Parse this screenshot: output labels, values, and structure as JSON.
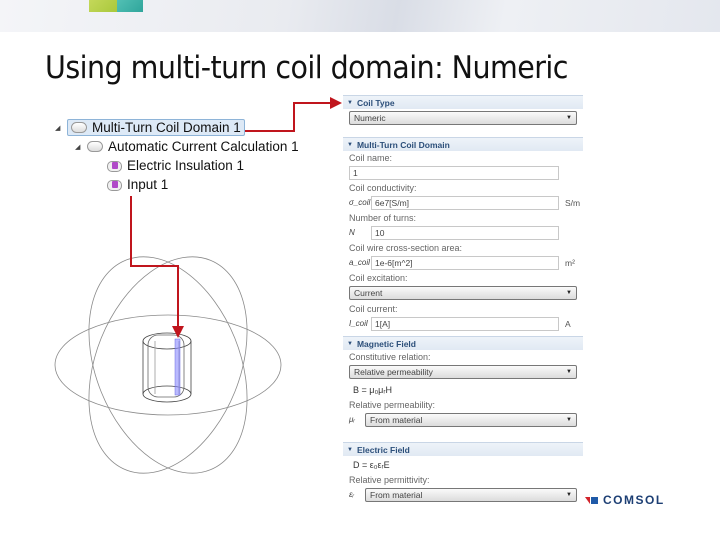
{
  "slide": {
    "title": "Using multi-turn coil domain: Numeric"
  },
  "tree": {
    "items": [
      {
        "label": "Multi-Turn Coil Domain 1",
        "icon": "domain-node-icon",
        "selected": true
      },
      {
        "label": "Automatic Current Calculation 1",
        "icon": "domain-node-icon"
      },
      {
        "label": "Electric Insulation 1",
        "icon": "boundary-condition-icon"
      },
      {
        "label": "Input 1",
        "icon": "boundary-condition-icon"
      }
    ]
  },
  "panel": {
    "coil_type": {
      "header": "Coil Type",
      "value": "Numeric"
    },
    "multi_turn": {
      "header": "Multi-Turn Coil Domain",
      "coil_name_label": "Coil name:",
      "coil_name_value": "1",
      "conductivity_label": "Coil conductivity:",
      "conductivity_symbol": "σ_coil",
      "conductivity_value": "6e7[S/m]",
      "conductivity_unit": "S/m",
      "turns_label": "Number of turns:",
      "turns_symbol": "N",
      "turns_value": "10",
      "area_label": "Coil wire cross-section area:",
      "area_symbol": "a_coil",
      "area_value": "1e-6[m^2]",
      "area_unit": "m²",
      "excitation_label": "Coil excitation:",
      "excitation_value": "Current",
      "current_label": "Coil current:",
      "current_symbol": "I_coil",
      "current_value": "1[A]",
      "current_unit": "A"
    },
    "magnetic": {
      "header": "Magnetic Field",
      "relation_label": "Constitutive relation:",
      "relation_value": "Relative permeability",
      "equation": "B = μ₀μᵣH",
      "permeability_label": "Relative permeability:",
      "permeability_symbol": "μᵣ",
      "permeability_value": "From material"
    },
    "electric": {
      "header": "Electric Field",
      "equation": "D = ε₀εᵣE",
      "permittivity_label": "Relative permittivity:",
      "permittivity_symbol": "εᵣ",
      "permittivity_value": "From material"
    }
  },
  "branding": {
    "logo_text": "COMSOL"
  },
  "colors": {
    "arrow": "#c0151d",
    "header_text": "#2c4f7a",
    "coil_highlight": "#8080ff"
  }
}
